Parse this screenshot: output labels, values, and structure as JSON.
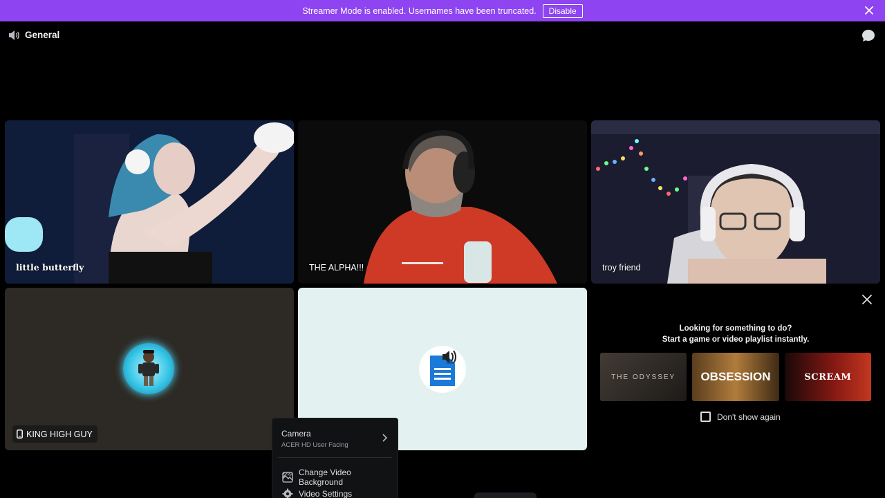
{
  "banner": {
    "message": "Streamer Mode is enabled. Usernames have been truncated.",
    "disable_label": "Disable"
  },
  "header": {
    "channel_name": "General"
  },
  "tiles": [
    {
      "name": "little butterfly"
    },
    {
      "name": "THE ALPHA!!!"
    },
    {
      "name": "troy friend"
    },
    {
      "name": "KING HIGH GUY"
    }
  ],
  "activity": {
    "line1": "Looking for something to do?",
    "line2": "Start a game or video playlist instantly.",
    "cards": [
      {
        "title": "THE ODYSSEY"
      },
      {
        "title": "OBSESSION"
      },
      {
        "title": "SCREAM"
      }
    ],
    "dont_show": "Don't show again"
  },
  "menu": {
    "camera_label": "Camera",
    "camera_device": "ACER HD User Facing",
    "change_bg": "Change Video Background",
    "settings": "Video Settings"
  },
  "colors": {
    "banner": "#8e44f0",
    "background": "#000000",
    "doc_icon": "#1b79d8"
  }
}
